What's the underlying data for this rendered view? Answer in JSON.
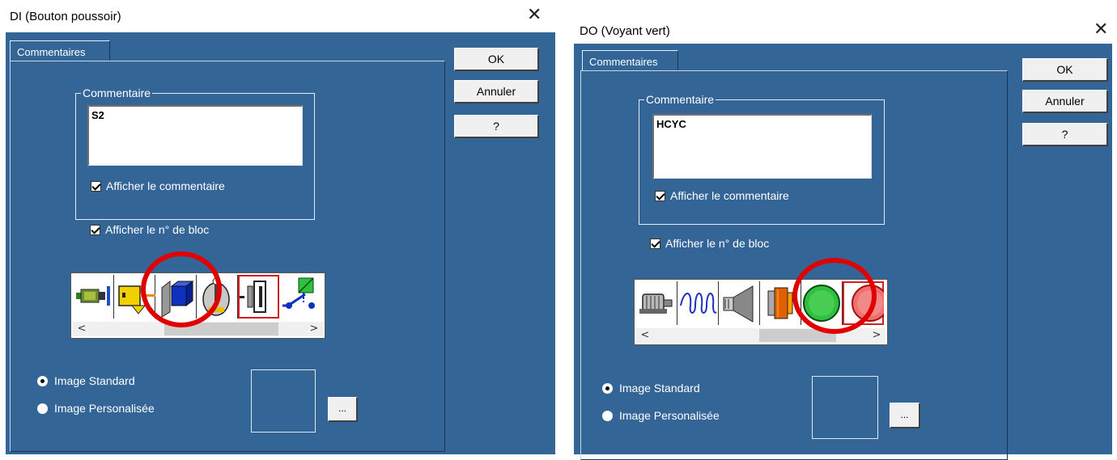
{
  "dialogs": [
    {
      "title": "DI (Bouton poussoir)",
      "close_glyph": "✕",
      "tab_label": "Commentaires",
      "buttons": {
        "ok": "OK",
        "cancel": "Annuler",
        "help": "?"
      },
      "comment_group_label": "Commentaire",
      "comment_value": "S2",
      "show_comment_label": "Afficher le commentaire",
      "show_comment_checked": true,
      "show_block_no_label": "Afficher le n° de bloc",
      "show_block_no_checked": true,
      "gallery_icons": [
        "inductive-sensor-icon",
        "photoelectric-sensor-icon",
        "push-button-icon",
        "rotary-switch-icon",
        "stop-button-icon",
        "limit-switch-icon"
      ],
      "gallery_selected": "stop-button-icon",
      "gallery_scroll_arrows": {
        "left": "<",
        "right": ">"
      },
      "radio_standard_label": "Image Standard",
      "radio_custom_label": "Image Personalisée",
      "radio_selected": "standard",
      "browse_label": "...",
      "annotation_color": "#e00000"
    },
    {
      "title": "DO (Voyant vert)",
      "close_glyph": "✕",
      "tab_label": "Commentaires",
      "buttons": {
        "ok": "OK",
        "cancel": "Annuler",
        "help": "?"
      },
      "comment_group_label": "Commentaire",
      "comment_value": "HCYC",
      "show_comment_label": "Afficher le commentaire",
      "show_comment_checked": true,
      "show_block_no_label": "Afficher le n° de bloc",
      "show_block_no_checked": true,
      "gallery_icons": [
        "motor-icon",
        "coil-icon",
        "horn-icon",
        "warning-light-icon",
        "green-indicator-light-icon",
        "red-indicator-light-icon"
      ],
      "gallery_selected": "red-indicator-light-icon",
      "gallery_scroll_arrows": {
        "left": "<",
        "right": ">"
      },
      "radio_standard_label": "Image Standard",
      "radio_custom_label": "Image Personalisée",
      "radio_selected": "standard",
      "browse_label": "...",
      "annotation_color": "#e00000"
    }
  ],
  "colors": {
    "client_bg": "#346597",
    "button_face": "#f0f0f0",
    "selection_outline": "#d02020"
  }
}
